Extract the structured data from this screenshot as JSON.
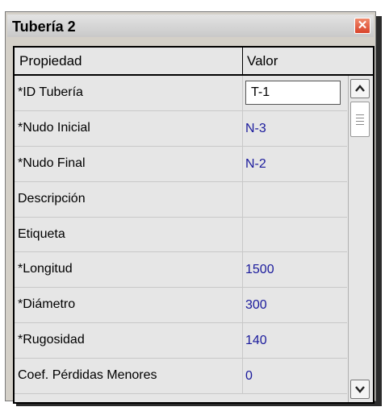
{
  "window": {
    "title": "Tubería 2",
    "close_glyph": "✕"
  },
  "table": {
    "headers": {
      "property": "Propiedad",
      "value": "Valor"
    },
    "rows": [
      {
        "property": "*ID Tubería",
        "value": "T-1"
      },
      {
        "property": "*Nudo Inicial",
        "value": "N-3"
      },
      {
        "property": "*Nudo Final",
        "value": "N-2"
      },
      {
        "property": "Descripción",
        "value": ""
      },
      {
        "property": "Etiqueta",
        "value": ""
      },
      {
        "property": "*Longitud",
        "value": "1500"
      },
      {
        "property": "*Diámetro",
        "value": "300"
      },
      {
        "property": "*Rugosidad",
        "value": "140"
      },
      {
        "property": "Coef. Pérdidas Menores",
        "value": "0"
      }
    ]
  },
  "icons": {
    "close": "close-icon",
    "up": "arrow-up-icon",
    "down": "arrow-down-icon"
  },
  "colors": {
    "value_text": "#1a1a9c",
    "close_button": "#d9432a"
  }
}
